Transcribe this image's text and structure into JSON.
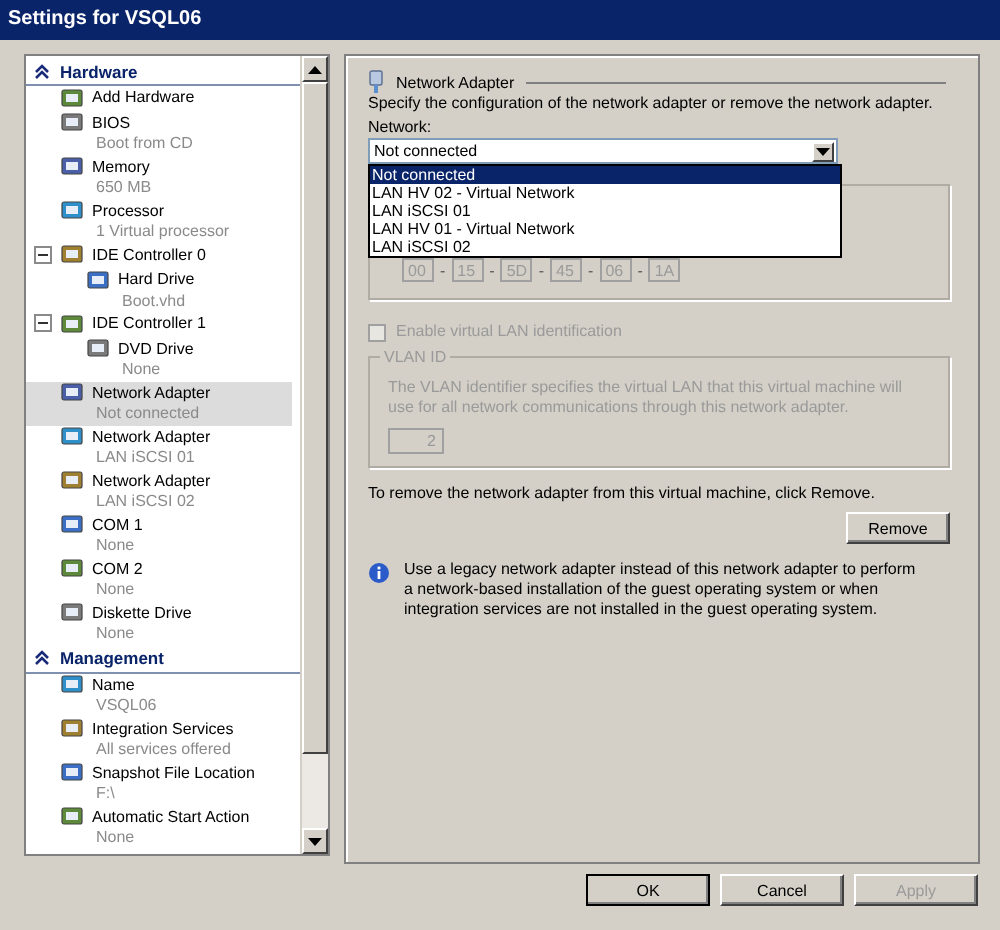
{
  "window": {
    "title": "Settings for VSQL06"
  },
  "sidebar": {
    "sections": [
      {
        "title": "Hardware",
        "expanded": true,
        "items": [
          {
            "label": "Add Hardware",
            "selected": false
          },
          {
            "label": "BIOS",
            "detail": "Boot from CD",
            "selected": false
          },
          {
            "label": "Memory",
            "detail": "650 MB",
            "selected": false
          },
          {
            "label": "Processor",
            "detail": "1 Virtual processor",
            "selected": false
          },
          {
            "label": "IDE Controller 0",
            "selected": false,
            "expanded": true,
            "children": [
              {
                "label": "Hard Drive",
                "detail": "Boot.vhd",
                "selected": false
              }
            ]
          },
          {
            "label": "IDE Controller 1",
            "selected": false,
            "expanded": true,
            "children": [
              {
                "label": "DVD Drive",
                "detail": "None",
                "selected": false
              }
            ]
          },
          {
            "label": "Network Adapter",
            "detail": "Not connected",
            "selected": true
          },
          {
            "label": "Network Adapter",
            "detail": "LAN iSCSI 01",
            "selected": false
          },
          {
            "label": "Network Adapter",
            "detail": "LAN iSCSI 02",
            "selected": false
          },
          {
            "label": "COM 1",
            "detail": "None",
            "selected": false
          },
          {
            "label": "COM 2",
            "detail": "None",
            "selected": false
          },
          {
            "label": "Diskette Drive",
            "detail": "None",
            "selected": false
          }
        ]
      },
      {
        "title": "Management",
        "expanded": true,
        "items": [
          {
            "label": "Name",
            "detail": "VSQL06",
            "selected": false
          },
          {
            "label": "Integration Services",
            "detail": "All services offered",
            "selected": false
          },
          {
            "label": "Snapshot File Location",
            "detail": "F:\\",
            "selected": false
          },
          {
            "label": "Automatic Start Action",
            "detail": "None",
            "selected": false
          }
        ]
      }
    ]
  },
  "panel": {
    "title": "Network Adapter",
    "description": "Specify the configuration of the network adapter or remove the network adapter.",
    "network": {
      "label": "Network:",
      "value": "Not connected",
      "open": true,
      "options": [
        {
          "label": "Not connected",
          "selected": true
        },
        {
          "label": "LAN HV 02 - Virtual Network",
          "selected": false
        },
        {
          "label": "LAN iSCSI 01",
          "selected": false
        },
        {
          "label": "LAN HV 01 - Virtual Network",
          "selected": false
        },
        {
          "label": "LAN iSCSI 02",
          "selected": false
        }
      ]
    },
    "mac_address": {
      "parts": [
        "00",
        "15",
        "5D",
        "45",
        "06",
        "1A"
      ],
      "separator": "-",
      "disabled": true
    },
    "vlan_checkbox": {
      "label": "Enable virtual LAN identification",
      "checked": false,
      "disabled": true
    },
    "vlan_group": {
      "title": "VLAN ID",
      "description": "The VLAN identifier specifies the virtual LAN that this virtual machine will use for all network communications through this network adapter.",
      "value": "2",
      "disabled": true
    },
    "remove_text": "To remove the network adapter from this virtual machine, click Remove.",
    "remove_button": "Remove",
    "info": "Use a legacy network adapter instead of this network adapter to perform a network-based installation of the guest operating system or when integration services are not installed in the guest operating system."
  },
  "buttons": [
    {
      "label": "OK",
      "disabled": false,
      "default": true
    },
    {
      "label": "Cancel",
      "disabled": false,
      "default": false
    },
    {
      "label": "Apply",
      "disabled": true,
      "default": false
    }
  ]
}
